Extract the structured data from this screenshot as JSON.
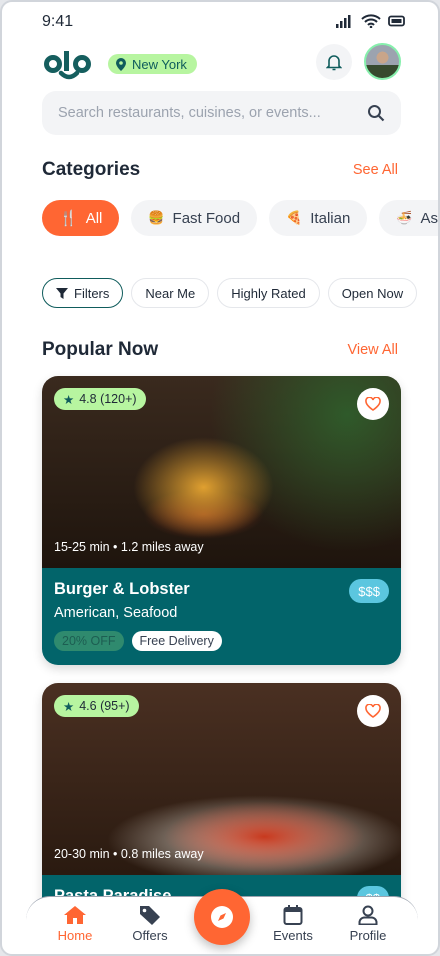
{
  "status": {
    "time": "9:41"
  },
  "header": {
    "logo": "olo",
    "location": "New York"
  },
  "search": {
    "placeholder": "Search restaurants, cuisines, or events..."
  },
  "categories": {
    "title": "Categories",
    "see_all": "See All",
    "items": [
      {
        "label": "All",
        "icon": "utensils-icon",
        "active": true
      },
      {
        "label": "Fast Food",
        "icon": "burger-icon"
      },
      {
        "label": "Italian",
        "icon": "pizza-icon"
      },
      {
        "label": "Asian",
        "icon": "bowl-icon"
      }
    ]
  },
  "filters": [
    {
      "label": "Filters",
      "icon": "filter-icon",
      "active": true
    },
    {
      "label": "Near Me"
    },
    {
      "label": "Highly Rated"
    },
    {
      "label": "Open Now"
    }
  ],
  "popular": {
    "title": "Popular Now",
    "view_all": "View All",
    "restaurants": [
      {
        "rating": "4.8 (120+)",
        "meta": "15-25 min • 1.2 miles away",
        "name": "Burger & Lobster",
        "cuisine": "American, Seafood",
        "price": "$$$",
        "tags": [
          "20% OFF",
          "Free Delivery"
        ]
      },
      {
        "rating": "4.6 (95+)",
        "meta": "20-30 min • 0.8 miles away",
        "name": "Pasta Paradise",
        "price": "$$"
      }
    ]
  },
  "nav": {
    "items": [
      "Home",
      "Offers",
      "Events",
      "Profile"
    ],
    "active": "Home"
  },
  "colors": {
    "accent": "#ff6633",
    "brand": "#0f5c5c",
    "card": "#02646a",
    "lime": "#b7f5a0"
  }
}
